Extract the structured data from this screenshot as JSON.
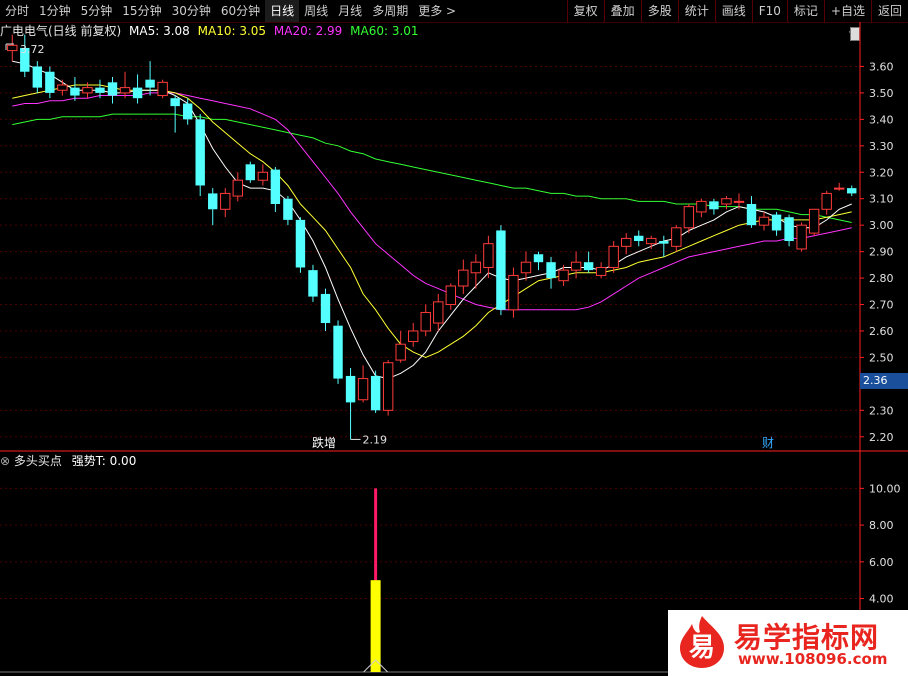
{
  "toolbar": {
    "periods": [
      "分时",
      "1分钟",
      "5分钟",
      "15分钟",
      "30分钟",
      "60分钟",
      "日线",
      "周线",
      "月线",
      "多周期",
      "更多 >"
    ],
    "active_period": "日线",
    "actions": [
      "复权",
      "叠加",
      "多股",
      "统计",
      "画线",
      "F10",
      "标记",
      "+自选",
      "返回"
    ]
  },
  "header": {
    "title": "广电电气(日线 前复权)",
    "ma5": "MA5: 3.08",
    "ma10": "MA10: 3.05",
    "ma20": "MA20: 2.99",
    "ma60": "MA60: 3.01"
  },
  "sub_header": {
    "indicator": "多头买点",
    "param": "强势T: 0.00"
  },
  "colors": {
    "up": "#ff3b3b",
    "down": "#54ffff",
    "ma5": "#ffffff",
    "ma10": "#ffff33",
    "ma20": "#ff33ff",
    "ma60": "#33ff33",
    "grid": "#4d0000",
    "axis": "#ff2020"
  },
  "price_axis": {
    "labels": [
      "3.60",
      "3.50",
      "3.40",
      "3.30",
      "3.20",
      "3.10",
      "3.00",
      "2.90",
      "2.80",
      "2.70",
      "2.60",
      "2.50",
      "2.30",
      "2.20"
    ],
    "current": "2.36"
  },
  "indicator_axis": {
    "labels": [
      "10.00",
      "8.00",
      "6.00",
      "4.00"
    ]
  },
  "annotations": {
    "high": "3.72",
    "low": "2.19",
    "tag_fall": "跌增",
    "tag_fin": "财"
  },
  "chart_data": {
    "type": "candlestick",
    "ylim": [
      2.15,
      3.7
    ],
    "candles": [
      [
        3.66,
        3.68,
        3.62,
        3.72
      ],
      [
        3.67,
        3.58,
        3.56,
        3.72
      ],
      [
        3.6,
        3.52,
        3.5,
        3.62
      ],
      [
        3.58,
        3.5,
        3.48,
        3.6
      ],
      [
        3.51,
        3.53,
        3.49,
        3.55
      ],
      [
        3.52,
        3.49,
        3.47,
        3.56
      ],
      [
        3.5,
        3.52,
        3.48,
        3.54
      ],
      [
        3.52,
        3.5,
        3.48,
        3.55
      ],
      [
        3.54,
        3.49,
        3.46,
        3.56
      ],
      [
        3.5,
        3.52,
        3.48,
        3.58
      ],
      [
        3.52,
        3.48,
        3.46,
        3.57
      ],
      [
        3.55,
        3.52,
        3.49,
        3.62
      ],
      [
        3.49,
        3.54,
        3.48,
        3.55
      ],
      [
        3.48,
        3.45,
        3.35,
        3.49
      ],
      [
        3.46,
        3.4,
        3.38,
        3.48
      ],
      [
        3.4,
        3.15,
        3.11,
        3.42
      ],
      [
        3.12,
        3.06,
        3.0,
        3.14
      ],
      [
        3.06,
        3.12,
        3.03,
        3.14
      ],
      [
        3.11,
        3.17,
        3.09,
        3.2
      ],
      [
        3.23,
        3.17,
        3.16,
        3.24
      ],
      [
        3.17,
        3.2,
        3.15,
        3.23
      ],
      [
        3.21,
        3.08,
        3.05,
        3.22
      ],
      [
        3.1,
        3.02,
        3.0,
        3.11
      ],
      [
        3.02,
        2.84,
        2.82,
        3.03
      ],
      [
        2.83,
        2.73,
        2.71,
        2.85
      ],
      [
        2.74,
        2.63,
        2.6,
        2.76
      ],
      [
        2.62,
        2.42,
        2.4,
        2.64
      ],
      [
        2.43,
        2.33,
        2.19,
        2.46
      ],
      [
        2.34,
        2.42,
        2.33,
        2.47
      ],
      [
        2.43,
        2.3,
        2.29,
        2.45
      ],
      [
        2.3,
        2.48,
        2.28,
        2.49
      ],
      [
        2.49,
        2.55,
        2.48,
        2.6
      ],
      [
        2.56,
        2.6,
        2.54,
        2.63
      ],
      [
        2.6,
        2.67,
        2.58,
        2.7
      ],
      [
        2.63,
        2.71,
        2.6,
        2.74
      ],
      [
        2.7,
        2.77,
        2.68,
        2.78
      ],
      [
        2.77,
        2.83,
        2.74,
        2.87
      ],
      [
        2.82,
        2.86,
        2.76,
        2.89
      ],
      [
        2.84,
        2.93,
        2.8,
        2.96
      ],
      [
        2.98,
        2.68,
        2.66,
        3.0
      ],
      [
        2.68,
        2.81,
        2.65,
        2.84
      ],
      [
        2.82,
        2.86,
        2.79,
        2.9
      ],
      [
        2.89,
        2.86,
        2.83,
        2.9
      ],
      [
        2.86,
        2.8,
        2.76,
        2.88
      ],
      [
        2.79,
        2.83,
        2.77,
        2.85
      ],
      [
        2.83,
        2.86,
        2.8,
        2.9
      ],
      [
        2.86,
        2.83,
        2.82,
        2.9
      ],
      [
        2.81,
        2.84,
        2.8,
        2.86
      ],
      [
        2.84,
        2.92,
        2.82,
        2.94
      ],
      [
        2.92,
        2.95,
        2.89,
        2.97
      ],
      [
        2.96,
        2.94,
        2.92,
        2.98
      ],
      [
        2.93,
        2.95,
        2.91,
        2.96
      ],
      [
        2.94,
        2.93,
        2.88,
        2.96
      ],
      [
        2.92,
        2.99,
        2.9,
        3.0
      ],
      [
        2.99,
        3.07,
        2.97,
        3.08
      ],
      [
        3.05,
        3.09,
        3.03,
        3.1
      ],
      [
        3.09,
        3.06,
        3.04,
        3.1
      ],
      [
        3.08,
        3.1,
        3.06,
        3.11
      ],
      [
        3.09,
        3.09,
        3.06,
        3.12
      ],
      [
        3.08,
        3.0,
        2.99,
        3.11
      ],
      [
        3.0,
        3.03,
        2.98,
        3.05
      ],
      [
        3.04,
        2.98,
        2.96,
        3.05
      ],
      [
        3.03,
        2.94,
        2.92,
        3.04
      ],
      [
        2.91,
        3.0,
        2.9,
        3.01
      ],
      [
        2.97,
        3.06,
        2.96,
        3.06
      ],
      [
        3.06,
        3.12,
        3.04,
        3.13
      ],
      [
        3.14,
        3.14,
        3.13,
        3.16
      ],
      [
        3.14,
        3.12,
        3.11,
        3.15
      ]
    ],
    "ma5": [
      3.62,
      3.61,
      3.59,
      3.57,
      3.54,
      3.51,
      3.51,
      3.51,
      3.5,
      3.5,
      3.51,
      3.51,
      3.51,
      3.49,
      3.46,
      3.38,
      3.29,
      3.22,
      3.16,
      3.14,
      3.14,
      3.13,
      3.09,
      3.02,
      2.94,
      2.84,
      2.72,
      2.61,
      2.51,
      2.43,
      2.42,
      2.44,
      2.47,
      2.52,
      2.6,
      2.66,
      2.72,
      2.77,
      2.82,
      2.8,
      2.79,
      2.8,
      2.81,
      2.82,
      2.84,
      2.84,
      2.84,
      2.83,
      2.85,
      2.88,
      2.9,
      2.92,
      2.94,
      2.95,
      2.98,
      3.0,
      3.02,
      3.05,
      3.07,
      3.06,
      3.05,
      3.03,
      3.0,
      2.99,
      2.99,
      3.02,
      3.06,
      3.08
    ],
    "ma10": [
      3.48,
      3.49,
      3.5,
      3.51,
      3.52,
      3.53,
      3.53,
      3.53,
      3.52,
      3.51,
      3.51,
      3.51,
      3.51,
      3.5,
      3.48,
      3.44,
      3.39,
      3.35,
      3.31,
      3.27,
      3.24,
      3.2,
      3.15,
      3.08,
      3.03,
      2.98,
      2.91,
      2.84,
      2.74,
      2.68,
      2.61,
      2.55,
      2.52,
      2.5,
      2.52,
      2.55,
      2.58,
      2.62,
      2.67,
      2.7,
      2.73,
      2.76,
      2.79,
      2.8,
      2.81,
      2.82,
      2.82,
      2.82,
      2.83,
      2.84,
      2.86,
      2.87,
      2.88,
      2.9,
      2.92,
      2.94,
      2.96,
      2.98,
      3.0,
      3.01,
      3.02,
      3.02,
      3.02,
      3.02,
      3.02,
      3.03,
      3.04,
      3.05
    ],
    "ma20": [
      3.45,
      3.46,
      3.46,
      3.47,
      3.47,
      3.48,
      3.48,
      3.49,
      3.49,
      3.49,
      3.49,
      3.5,
      3.5,
      3.5,
      3.49,
      3.48,
      3.47,
      3.46,
      3.45,
      3.44,
      3.42,
      3.4,
      3.36,
      3.3,
      3.24,
      3.18,
      3.12,
      3.05,
      2.99,
      2.93,
      2.89,
      2.85,
      2.81,
      2.78,
      2.76,
      2.74,
      2.72,
      2.7,
      2.69,
      2.68,
      2.68,
      2.68,
      2.68,
      2.68,
      2.68,
      2.68,
      2.69,
      2.71,
      2.74,
      2.77,
      2.8,
      2.82,
      2.84,
      2.86,
      2.88,
      2.89,
      2.9,
      2.91,
      2.92,
      2.93,
      2.94,
      2.94,
      2.95,
      2.95,
      2.96,
      2.97,
      2.98,
      2.99
    ],
    "ma60": [
      3.38,
      3.39,
      3.4,
      3.4,
      3.41,
      3.41,
      3.41,
      3.41,
      3.42,
      3.42,
      3.42,
      3.42,
      3.42,
      3.42,
      3.41,
      3.41,
      3.4,
      3.4,
      3.39,
      3.38,
      3.37,
      3.36,
      3.35,
      3.34,
      3.33,
      3.31,
      3.3,
      3.28,
      3.27,
      3.25,
      3.24,
      3.23,
      3.22,
      3.21,
      3.2,
      3.19,
      3.18,
      3.17,
      3.16,
      3.15,
      3.14,
      3.14,
      3.13,
      3.12,
      3.12,
      3.11,
      3.11,
      3.1,
      3.1,
      3.1,
      3.09,
      3.09,
      3.09,
      3.08,
      3.08,
      3.08,
      3.07,
      3.07,
      3.07,
      3.06,
      3.06,
      3.06,
      3.05,
      3.04,
      3.04,
      3.03,
      3.02,
      3.01
    ],
    "signal": {
      "index": 29,
      "value": 10.0,
      "yellow_value": 5.0
    },
    "indicator_ylim": [
      0,
      11
    ]
  }
}
